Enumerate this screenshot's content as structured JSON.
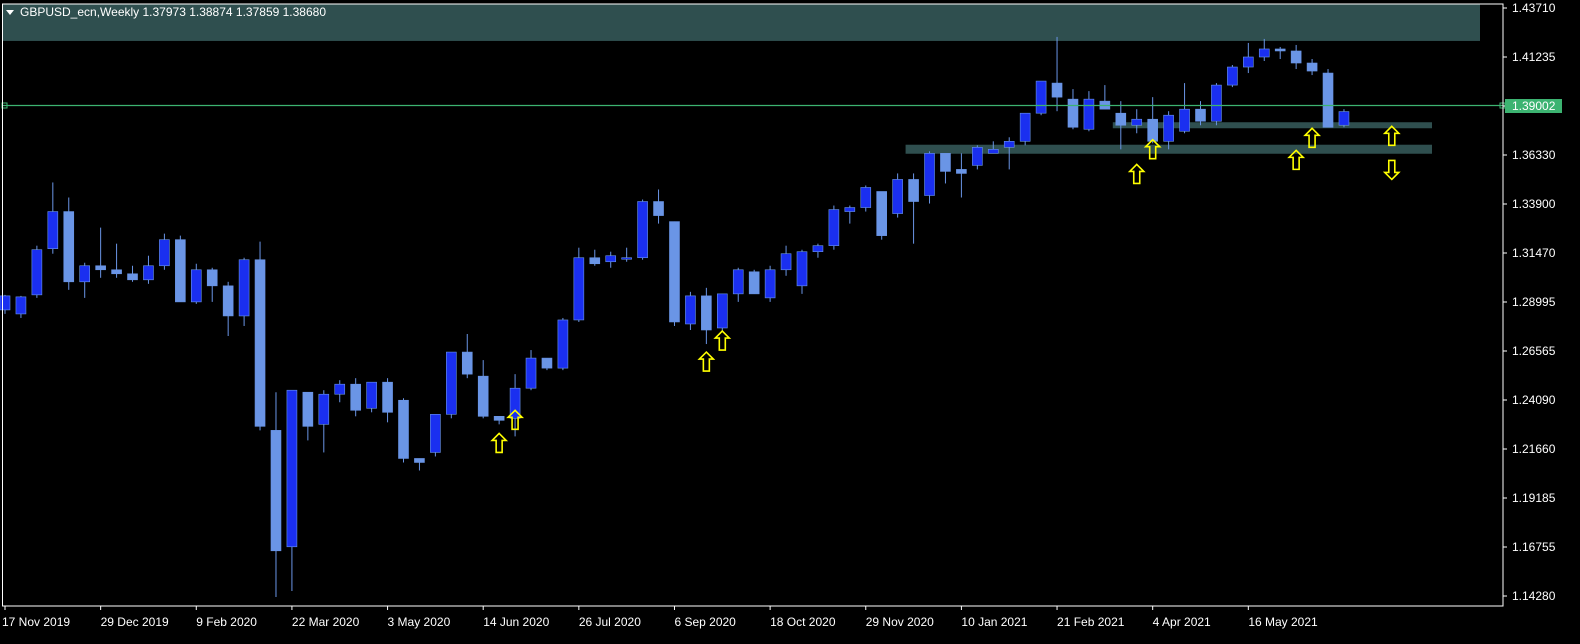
{
  "header": {
    "symbol_line": "GBPUSD_ecn,Weekly  1.37973 1.38874 1.37859 1.38680",
    "dropdown_icon": "triangle-down-icon"
  },
  "current_price_label": "1.39002",
  "colors": {
    "background": "#000000",
    "bull_body": "#1a2ff0",
    "bear_body": "#6a95e6",
    "wick": "#6a95e6",
    "zone_fill": "#2f4f4f",
    "price_line": "#3cb371",
    "arrow": "#ffff00",
    "axis": "#ffffff"
  },
  "chart_data": {
    "type": "candlestick",
    "symbol": "GBPUSD_ecn",
    "timeframe": "Weekly",
    "y_ticks": [
      "1.43710",
      "1.41235",
      "1.38760",
      "1.36330",
      "1.33900",
      "1.31470",
      "1.28995",
      "1.26565",
      "1.24090",
      "1.21660",
      "1.19185",
      "1.16755",
      "1.14280"
    ],
    "x_ticks": [
      "17 Nov 2019",
      "29 Dec 2019",
      "9 Feb 2020",
      "22 Mar 2020",
      "3 May 2020",
      "14 Jun 2020",
      "26 Jul 2020",
      "6 Sep 2020",
      "18 Oct 2020",
      "29 Nov 2020",
      "10 Jan 2021",
      "21 Feb 2021",
      "4 Apr 2021",
      "16 May 2021"
    ],
    "ylim": [
      1.1405,
      1.4404
    ],
    "current_price": 1.39002,
    "candles": [
      [
        1.288,
        1.2955,
        1.286,
        1.295
      ],
      [
        1.286,
        1.295,
        1.284,
        1.2945
      ],
      [
        1.2955,
        1.32,
        1.294,
        1.318
      ],
      [
        1.3185,
        1.3515,
        1.316,
        1.337
      ],
      [
        1.337,
        1.344,
        1.298,
        1.302
      ],
      [
        1.302,
        1.3115,
        1.294,
        1.31
      ],
      [
        1.31,
        1.329,
        1.304,
        1.308
      ],
      [
        1.308,
        1.321,
        1.304,
        1.306
      ],
      [
        1.306,
        1.31,
        1.302,
        1.303
      ],
      [
        1.303,
        1.315,
        1.301,
        1.31
      ],
      [
        1.31,
        1.326,
        1.308,
        1.323
      ],
      [
        1.323,
        1.325,
        1.292,
        1.292
      ],
      [
        1.292,
        1.311,
        1.291,
        1.308
      ],
      [
        1.308,
        1.309,
        1.292,
        1.3
      ],
      [
        1.3,
        1.302,
        1.275,
        1.285
      ],
      [
        1.285,
        1.314,
        1.28,
        1.313
      ],
      [
        1.313,
        1.322,
        1.228,
        1.23
      ],
      [
        1.228,
        1.247,
        1.145,
        1.168
      ],
      [
        1.17,
        1.248,
        1.148,
        1.248
      ],
      [
        1.247,
        1.247,
        1.223,
        1.23
      ],
      [
        1.231,
        1.248,
        1.217,
        1.246
      ],
      [
        1.246,
        1.253,
        1.242,
        1.251
      ],
      [
        1.251,
        1.254,
        1.235,
        1.238
      ],
      [
        1.239,
        1.252,
        1.237,
        1.252
      ],
      [
        1.252,
        1.254,
        1.232,
        1.237
      ],
      [
        1.243,
        1.244,
        1.212,
        1.214
      ],
      [
        1.214,
        1.214,
        1.208,
        1.212
      ],
      [
        1.217,
        1.236,
        1.215,
        1.236
      ],
      [
        1.236,
        1.266,
        1.234,
        1.267
      ],
      [
        1.267,
        1.276,
        1.254,
        1.256
      ],
      [
        1.255,
        1.263,
        1.234,
        1.235
      ],
      [
        1.235,
        1.235,
        1.231,
        1.233
      ],
      [
        1.234,
        1.256,
        1.225,
        1.249
      ],
      [
        1.249,
        1.268,
        1.248,
        1.264
      ],
      [
        1.264,
        1.264,
        1.258,
        1.259
      ],
      [
        1.259,
        1.284,
        1.258,
        1.283
      ],
      [
        1.283,
        1.319,
        1.282,
        1.314
      ],
      [
        1.314,
        1.318,
        1.31,
        1.311
      ],
      [
        1.312,
        1.317,
        1.309,
        1.315
      ],
      [
        1.314,
        1.319,
        1.312,
        1.314
      ],
      [
        1.314,
        1.343,
        1.313,
        1.342
      ],
      [
        1.342,
        1.348,
        1.331,
        1.335
      ],
      [
        1.332,
        1.332,
        1.28,
        1.282
      ],
      [
        1.281,
        1.297,
        1.278,
        1.295
      ],
      [
        1.295,
        1.299,
        1.271,
        1.278
      ],
      [
        1.279,
        1.296,
        1.277,
        1.296
      ],
      [
        1.296,
        1.309,
        1.292,
        1.308
      ],
      [
        1.307,
        1.308,
        1.296,
        1.296
      ],
      [
        1.294,
        1.31,
        1.292,
        1.308
      ],
      [
        1.308,
        1.32,
        1.305,
        1.316
      ],
      [
        1.3,
        1.318,
        1.296,
        1.317
      ],
      [
        1.317,
        1.321,
        1.314,
        1.32
      ],
      [
        1.32,
        1.34,
        1.318,
        1.338
      ],
      [
        1.337,
        1.34,
        1.331,
        1.339
      ],
      [
        1.339,
        1.35,
        1.337,
        1.349
      ],
      [
        1.347,
        1.347,
        1.323,
        1.325
      ],
      [
        1.336,
        1.356,
        1.334,
        1.353
      ],
      [
        1.353,
        1.356,
        1.321,
        1.342
      ],
      [
        1.345,
        1.367,
        1.341,
        1.366
      ],
      [
        1.366,
        1.364,
        1.351,
        1.357
      ],
      [
        1.358,
        1.366,
        1.344,
        1.356
      ],
      [
        1.36,
        1.37,
        1.358,
        1.369
      ],
      [
        1.366,
        1.372,
        1.366,
        1.368
      ],
      [
        1.369,
        1.374,
        1.358,
        1.372
      ],
      [
        1.372,
        1.38,
        1.37,
        1.386
      ],
      [
        1.386,
        1.401,
        1.385,
        1.402
      ],
      [
        1.401,
        1.424,
        1.387,
        1.394
      ],
      [
        1.393,
        1.398,
        1.378,
        1.379
      ],
      [
        1.378,
        1.397,
        1.377,
        1.393
      ],
      [
        1.392,
        1.4,
        1.388,
        1.388
      ],
      [
        1.386,
        1.392,
        1.368,
        1.38
      ],
      [
        1.38,
        1.388,
        1.376,
        1.383
      ],
      [
        1.383,
        1.394,
        1.371,
        1.372
      ],
      [
        1.372,
        1.387,
        1.368,
        1.385
      ],
      [
        1.377,
        1.401,
        1.376,
        1.388
      ],
      [
        1.388,
        1.392,
        1.38,
        1.382
      ],
      [
        1.382,
        1.401,
        1.38,
        1.4
      ],
      [
        1.4,
        1.41,
        1.399,
        1.409
      ],
      [
        1.409,
        1.421,
        1.406,
        1.414
      ],
      [
        1.414,
        1.423,
        1.412,
        1.418
      ],
      [
        1.418,
        1.419,
        1.413,
        1.417
      ],
      [
        1.417,
        1.42,
        1.408,
        1.411
      ],
      [
        1.411,
        1.413,
        1.405,
        1.407
      ],
      [
        1.406,
        1.408,
        1.379,
        1.379
      ],
      [
        1.38,
        1.388,
        1.379,
        1.3868
      ]
    ],
    "zones": [
      {
        "from": 1.422,
        "to": 1.4404,
        "start_index": 0
      },
      {
        "from": 1.3785,
        "to": 1.3815,
        "start_index": 70
      },
      {
        "from": 1.3658,
        "to": 1.3703,
        "start_index": 57
      }
    ],
    "arrows": [
      {
        "index": 31,
        "dir": "up",
        "price": 1.2215
      },
      {
        "index": 32,
        "dir": "up",
        "price": 1.233
      },
      {
        "index": 44,
        "dir": "up",
        "price": 1.262
      },
      {
        "index": 45,
        "dir": "up",
        "price": 1.2725
      },
      {
        "index": 71,
        "dir": "up",
        "price": 1.3555
      },
      {
        "index": 72,
        "dir": "up",
        "price": 1.3678
      },
      {
        "index": 81,
        "dir": "up",
        "price": 1.3625
      },
      {
        "index": 82,
        "dir": "up",
        "price": 1.3735
      },
      {
        "index": 87,
        "dir": "up",
        "price": 1.3745
      },
      {
        "index": 87,
        "dir": "down",
        "price": 1.358
      }
    ]
  }
}
